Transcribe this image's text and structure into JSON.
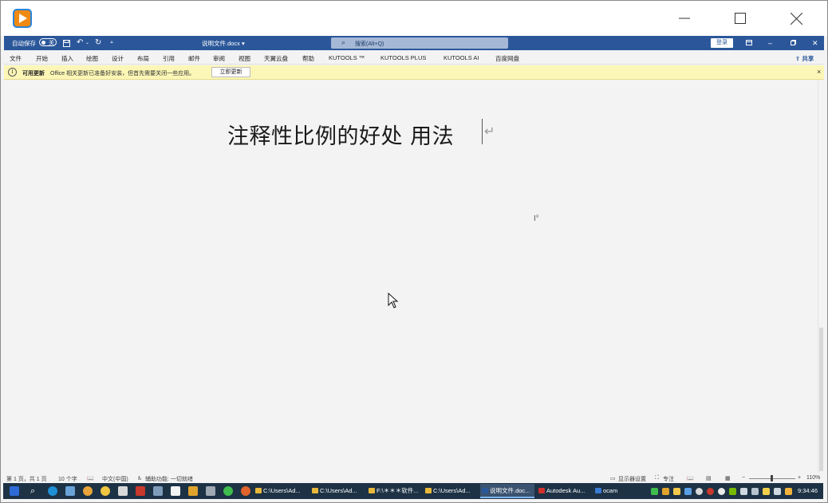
{
  "outer_window": {
    "app_icon": "play-icon",
    "controls": [
      "minimize-icon",
      "maximize-icon",
      "close-icon"
    ]
  },
  "word": {
    "autosave_label": "自动保存",
    "autosave_state": "关",
    "doc_name": "说明文件.docx ▾",
    "search_placeholder": "搜索(Alt+Q)",
    "login_label": "登录",
    "ribbon_tabs": [
      "文件",
      "开始",
      "插入",
      "绘图",
      "设计",
      "布局",
      "引用",
      "邮件",
      "审阅",
      "视图",
      "天翼云盘",
      "帮助",
      "KUTOOLS ™",
      "KUTOOLS PLUS",
      "KUTOOLS AI",
      "百度网盘"
    ],
    "share_label": "⇪ 共享",
    "message_bar": {
      "title": "可用更新",
      "text": "Office 相关更新已准备好安装，但首先需要关闭一些应用。",
      "button": "立即更新",
      "close": "×"
    },
    "document": {
      "heading": "注释性比例的好处  用法",
      "para_mark": "↵"
    },
    "status_bar": {
      "page": "第 1 页，共 1 页",
      "words": "10 个字",
      "language": "中文(中国)",
      "accessibility": "辅助功能: 一切就绪",
      "display_settings": "显示器设置",
      "focus": "专注",
      "zoom": "110%"
    }
  },
  "taskbar": {
    "tasks": [
      {
        "label": "C:\\Users\\Ad...",
        "type": "folder"
      },
      {
        "label": "C:\\Users\\Ad...",
        "type": "folder"
      },
      {
        "label": "F:\\＊＊＊软件...",
        "type": "folder"
      },
      {
        "label": "C:\\Users\\Ad...",
        "type": "folder"
      },
      {
        "label": "说明文件.doc...",
        "type": "word"
      },
      {
        "label": "Autodesk Au...",
        "type": "autodesk"
      },
      {
        "label": "ocam",
        "type": "ocam"
      }
    ],
    "clock": "9:34:46"
  }
}
